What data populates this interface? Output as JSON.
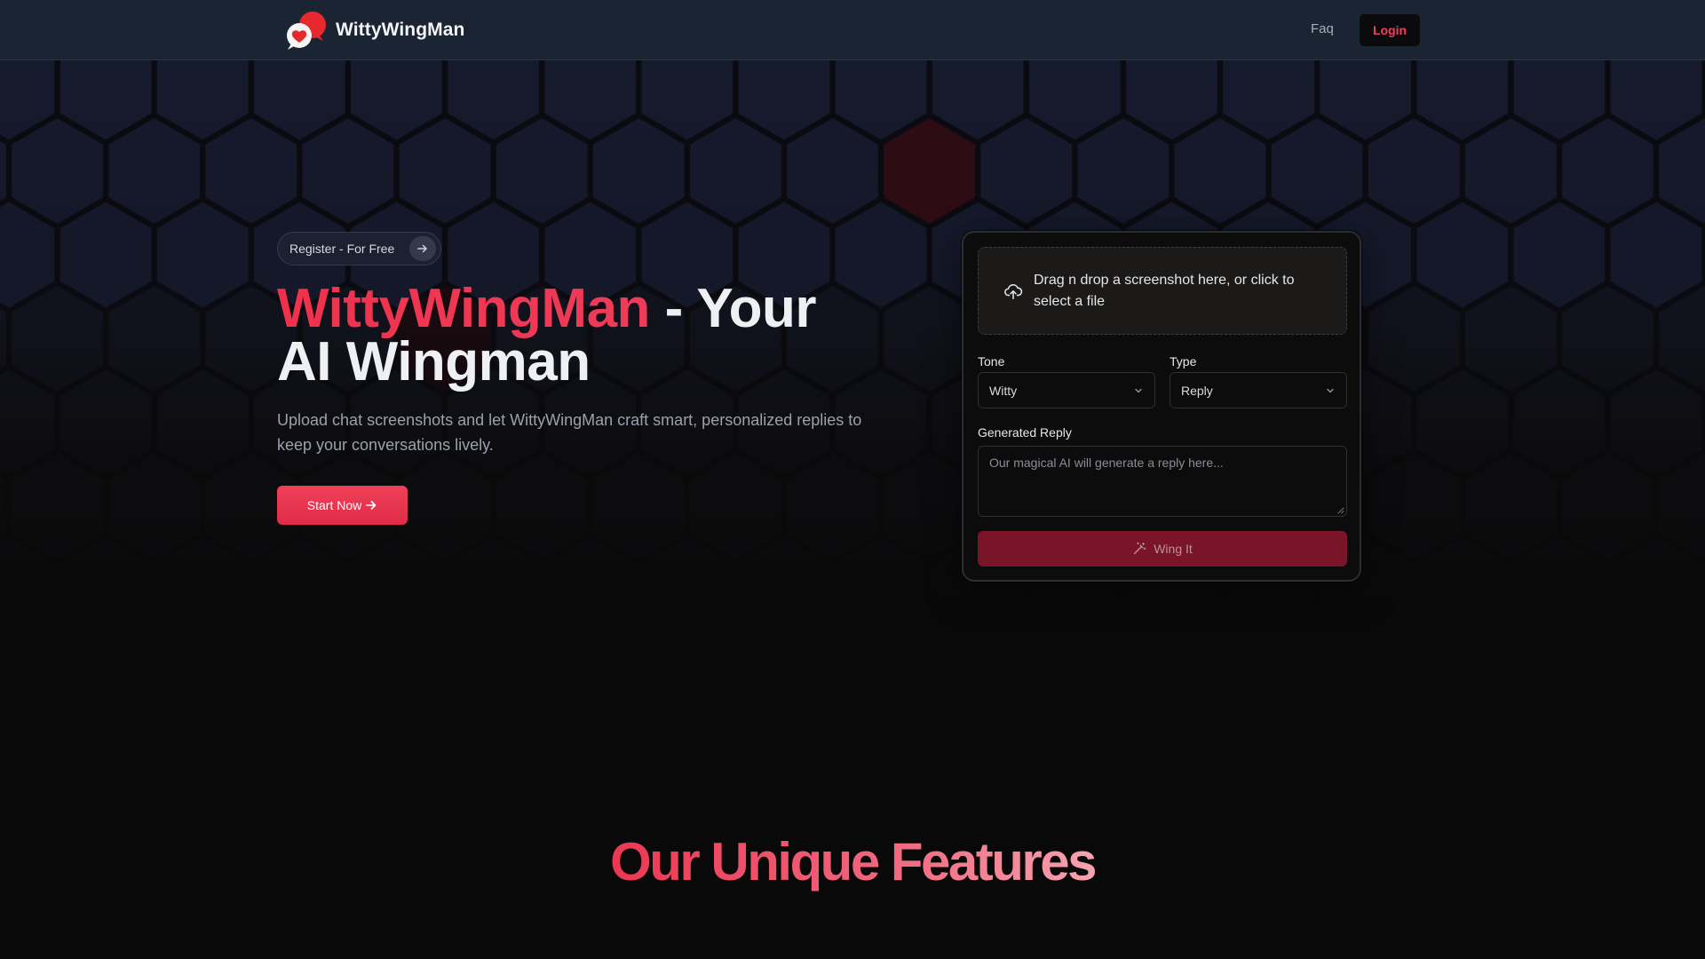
{
  "header": {
    "brand_name": "WittyWingMan",
    "nav_faq": "Faq",
    "login_label": "Login"
  },
  "hero": {
    "register_label": "Register - For Free",
    "title_accent": "WittyWingMan",
    "title_rest_1": " - Your",
    "title_rest_2": "AI Wingman",
    "subtitle": "Upload chat screenshots and let WittyWingMan craft smart, personalized replies to keep your conversations lively.",
    "start_label": "Start Now"
  },
  "form": {
    "dropzone_text": "Drag n drop a screenshot here, or click to select a file",
    "tone_label": "Tone",
    "tone_value": "Witty",
    "type_label": "Type",
    "type_value": "Reply",
    "reply_label": "Generated Reply",
    "reply_placeholder": "Our magical AI will generate a reply here...",
    "reply_value": "",
    "submit_label": "Wing It"
  },
  "features": {
    "title": "Our Unique Features"
  },
  "colors": {
    "accent": "#f0344f",
    "header_bg": "#1b2433",
    "page_bg": "#0a0909",
    "submit_bg": "#7a1429"
  },
  "icons": {
    "logo": "chat-bubbles-heart-logo",
    "register_arrow": "arrow-right-icon",
    "start_arrow": "arrow-right-icon",
    "upload": "cloud-upload-icon",
    "select_caret": "chevron-down-icon",
    "submit": "magic-wand-icon"
  }
}
